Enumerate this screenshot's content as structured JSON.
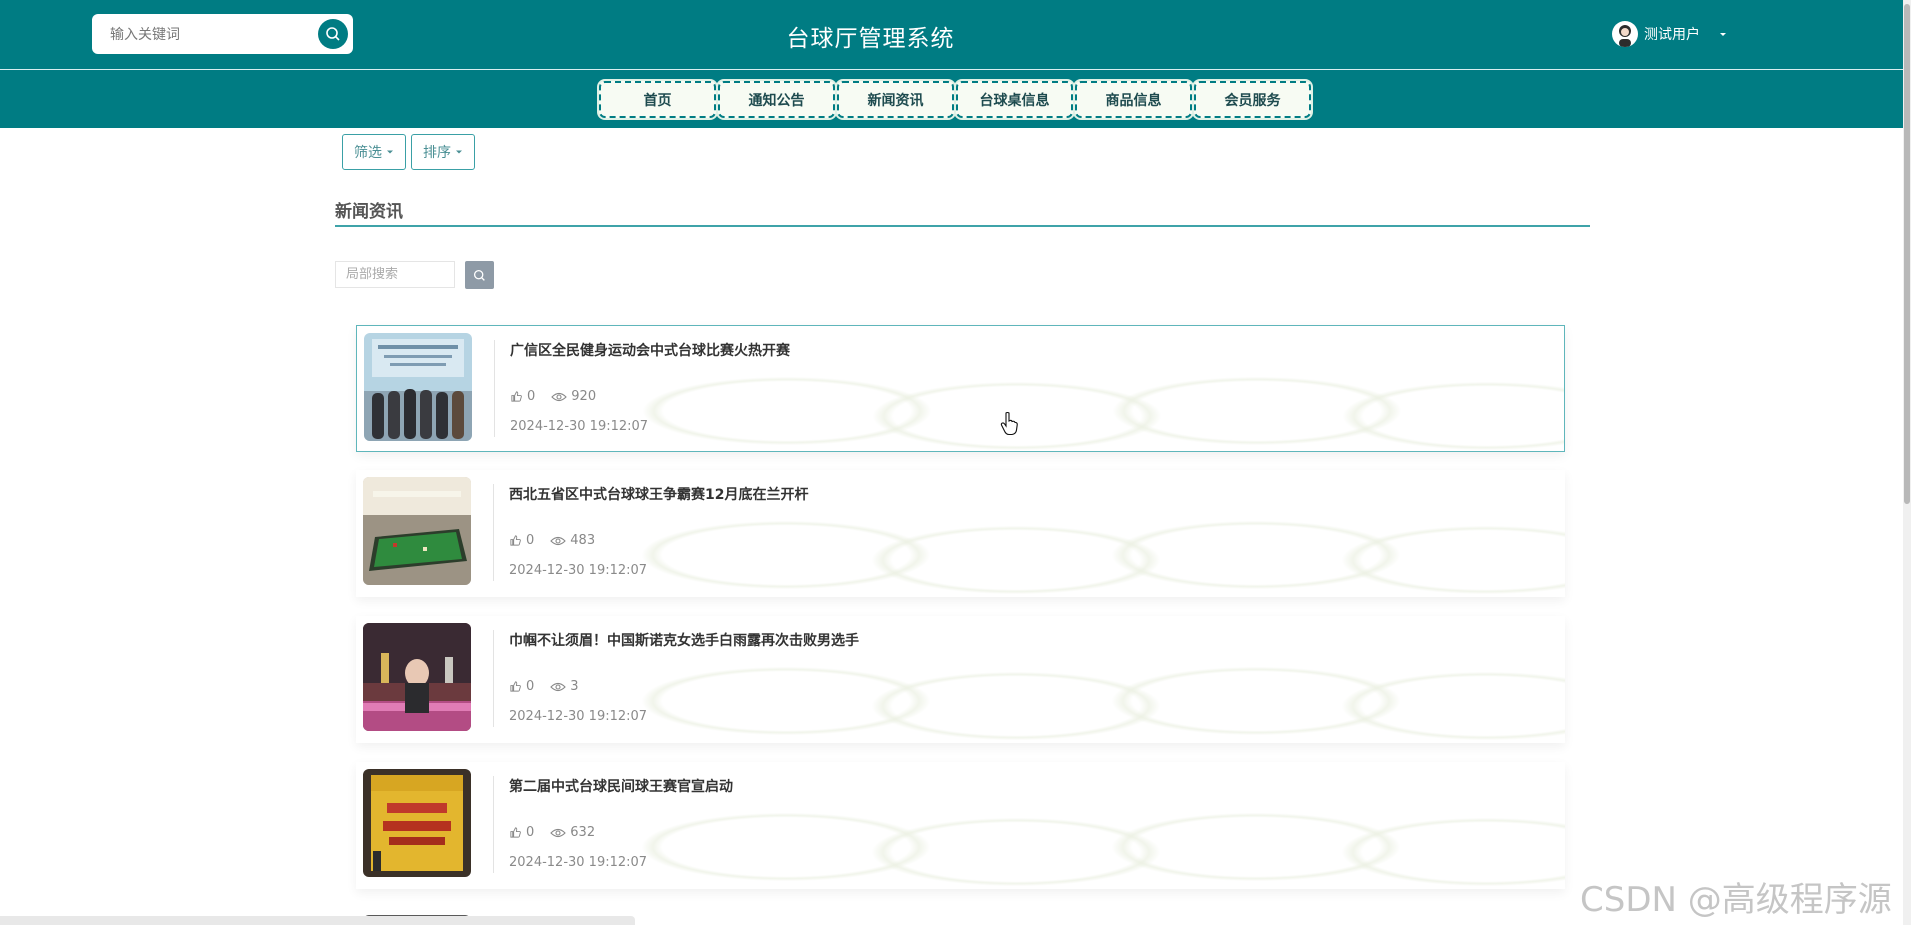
{
  "header": {
    "search_placeholder": "输入关键词",
    "title": "台球厅管理系统",
    "user_name": "测试用户"
  },
  "nav": {
    "items": [
      "首页",
      "通知公告",
      "新闻资讯",
      "台球桌信息",
      "商品信息",
      "会员服务"
    ]
  },
  "toolbar": {
    "filter_label": "筛选",
    "sort_label": "排序"
  },
  "section": {
    "title": "新闻资讯",
    "local_search_placeholder": "局部搜索"
  },
  "news": [
    {
      "title": "广信区全民健身运动会中式台球比赛火热开赛",
      "likes": "0",
      "views": "920",
      "date": "2024-12-30 19:12:07"
    },
    {
      "title": "西北五省区中式台球球王争霸赛12月底在兰开杆",
      "likes": "0",
      "views": "483",
      "date": "2024-12-30 19:12:07"
    },
    {
      "title": "巾帼不让须眉！中国斯诺克女选手白雨露再次击败男选手",
      "likes": "0",
      "views": "3",
      "date": "2024-12-30 19:12:07"
    },
    {
      "title": "第二届中式台球民间球王赛官宣启动",
      "likes": "0",
      "views": "632",
      "date": "2024-12-30 19:12:07"
    }
  ],
  "watermark": "CSDN @高级程序源",
  "colors": {
    "primary": "#007c83",
    "nav_bg": "#f7fbf3"
  }
}
